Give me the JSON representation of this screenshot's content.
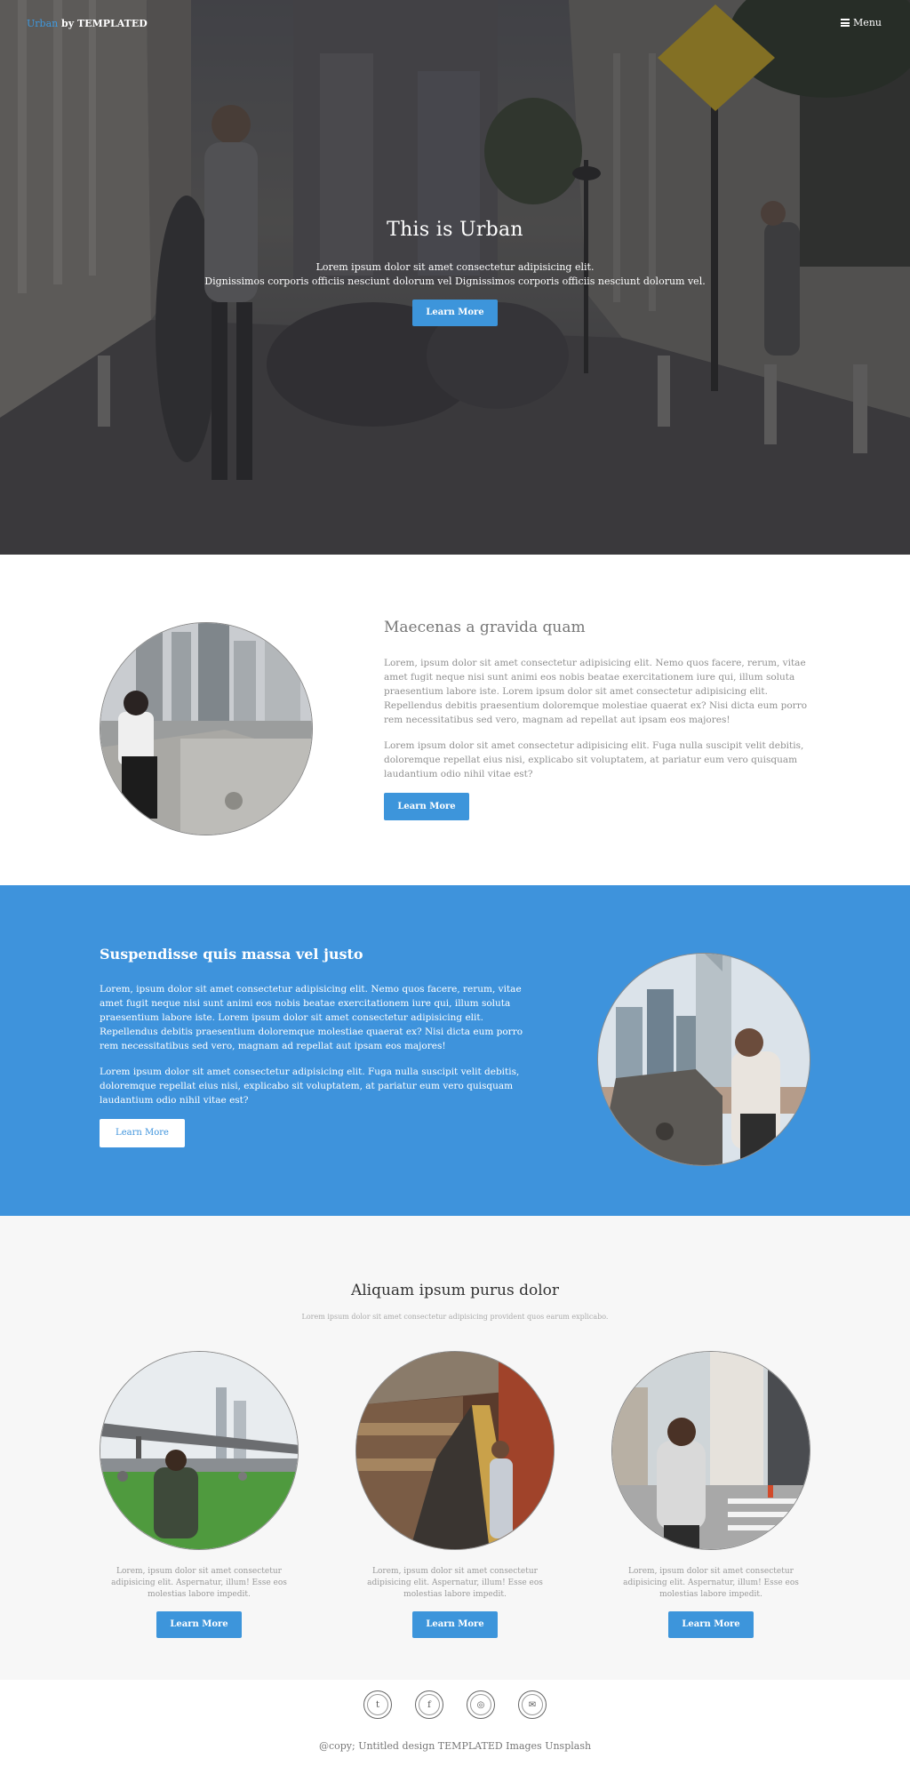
{
  "header": {
    "logo_brand": "Urban",
    "logo_rest": " by TEMPLATED",
    "menu_label": "Menu",
    "menu_icon": "bars-icon"
  },
  "banner": {
    "title": "This is Urban",
    "line1": "Lorem ipsum dolor sit amet consectetur adipisicing elit.",
    "line2": "Dignissimos corporis officiis nesciunt dolorum vel Dignissimos corporis officiis nesciunt dolorum vel.",
    "button": "Learn More"
  },
  "spotlight1": {
    "title": "Maecenas a gravida quam",
    "para1": "Lorem, ipsum dolor sit amet consectetur adipisicing elit. Nemo quos facere, rerum, vitae amet fugit neque nisi sunt animi eos nobis beatae exercitationem iure qui, illum soluta praesentium labore iste. Lorem ipsum dolor sit amet consectetur adipisicing elit. Repellendus debitis praesentium doloremque molestiae quaerat ex? Nisi dicta eum porro rem necessitatibus sed vero, magnam ad repellat aut ipsam eos majores!",
    "para2": "Lorem ipsum dolor sit amet consectetur adipisicing elit. Fuga nulla suscipit velit debitis, doloremque repellat eius nisi, explicabo sit voluptatem, at pariatur eum vero quisquam laudantium odio nihil vitae est?",
    "button": "Learn More"
  },
  "spotlight2": {
    "title": "Suspendisse quis massa vel justo",
    "para1": "Lorem, ipsum dolor sit amet consectetur adipisicing elit. Nemo quos facere, rerum, vitae amet fugit neque nisi sunt animi eos nobis beatae exercitationem iure qui, illum soluta praesentium labore iste. Lorem ipsum dolor sit amet consectetur adipisicing elit. Repellendus debitis praesentium doloremque molestiae quaerat ex? Nisi dicta eum porro rem necessitatibus sed vero, magnam ad repellat aut ipsam eos majores!",
    "para2": "Lorem ipsum dolor sit amet consectetur adipisicing elit. Fuga nulla suscipit velit debitis, doloremque repellat eius nisi, explicabo sit voluptatem, at pariatur eum vero quisquam laudantium odio nihil vitae est?",
    "button": "Learn More"
  },
  "three": {
    "title": "Aliquam ipsum purus dolor",
    "subtitle": "Lorem ipsum dolor sit amet consectetur adipisicing provident quos earum explicabo.",
    "items": [
      {
        "text": "Lorem, ipsum dolor sit amet consectetur adipisicing elit. Aspernatur, illum! Esse eos molestias labore impedit.",
        "button": "Learn More"
      },
      {
        "text": "Lorem, ipsum dolor sit amet consectetur adipisicing elit. Aspernatur, illum! Esse eos molestias labore impedit.",
        "button": "Learn More"
      },
      {
        "text": "Lorem, ipsum dolor sit amet consectetur adipisicing elit. Aspernatur, illum! Esse eos molestias labore impedit.",
        "button": "Learn More"
      }
    ]
  },
  "footer": {
    "icons": [
      {
        "name": "twitter-icon",
        "glyph": "t"
      },
      {
        "name": "facebook-icon",
        "glyph": "f"
      },
      {
        "name": "instagram-icon",
        "glyph": "◎"
      },
      {
        "name": "envelope-icon",
        "glyph": "✉"
      }
    ],
    "copyright": "@copy; Untitled design TEMPLATED Images Unsplash"
  },
  "colors": {
    "accent": "#3d95db",
    "accent_section": "#3e93dc",
    "light_section": "#f7f7f7"
  }
}
